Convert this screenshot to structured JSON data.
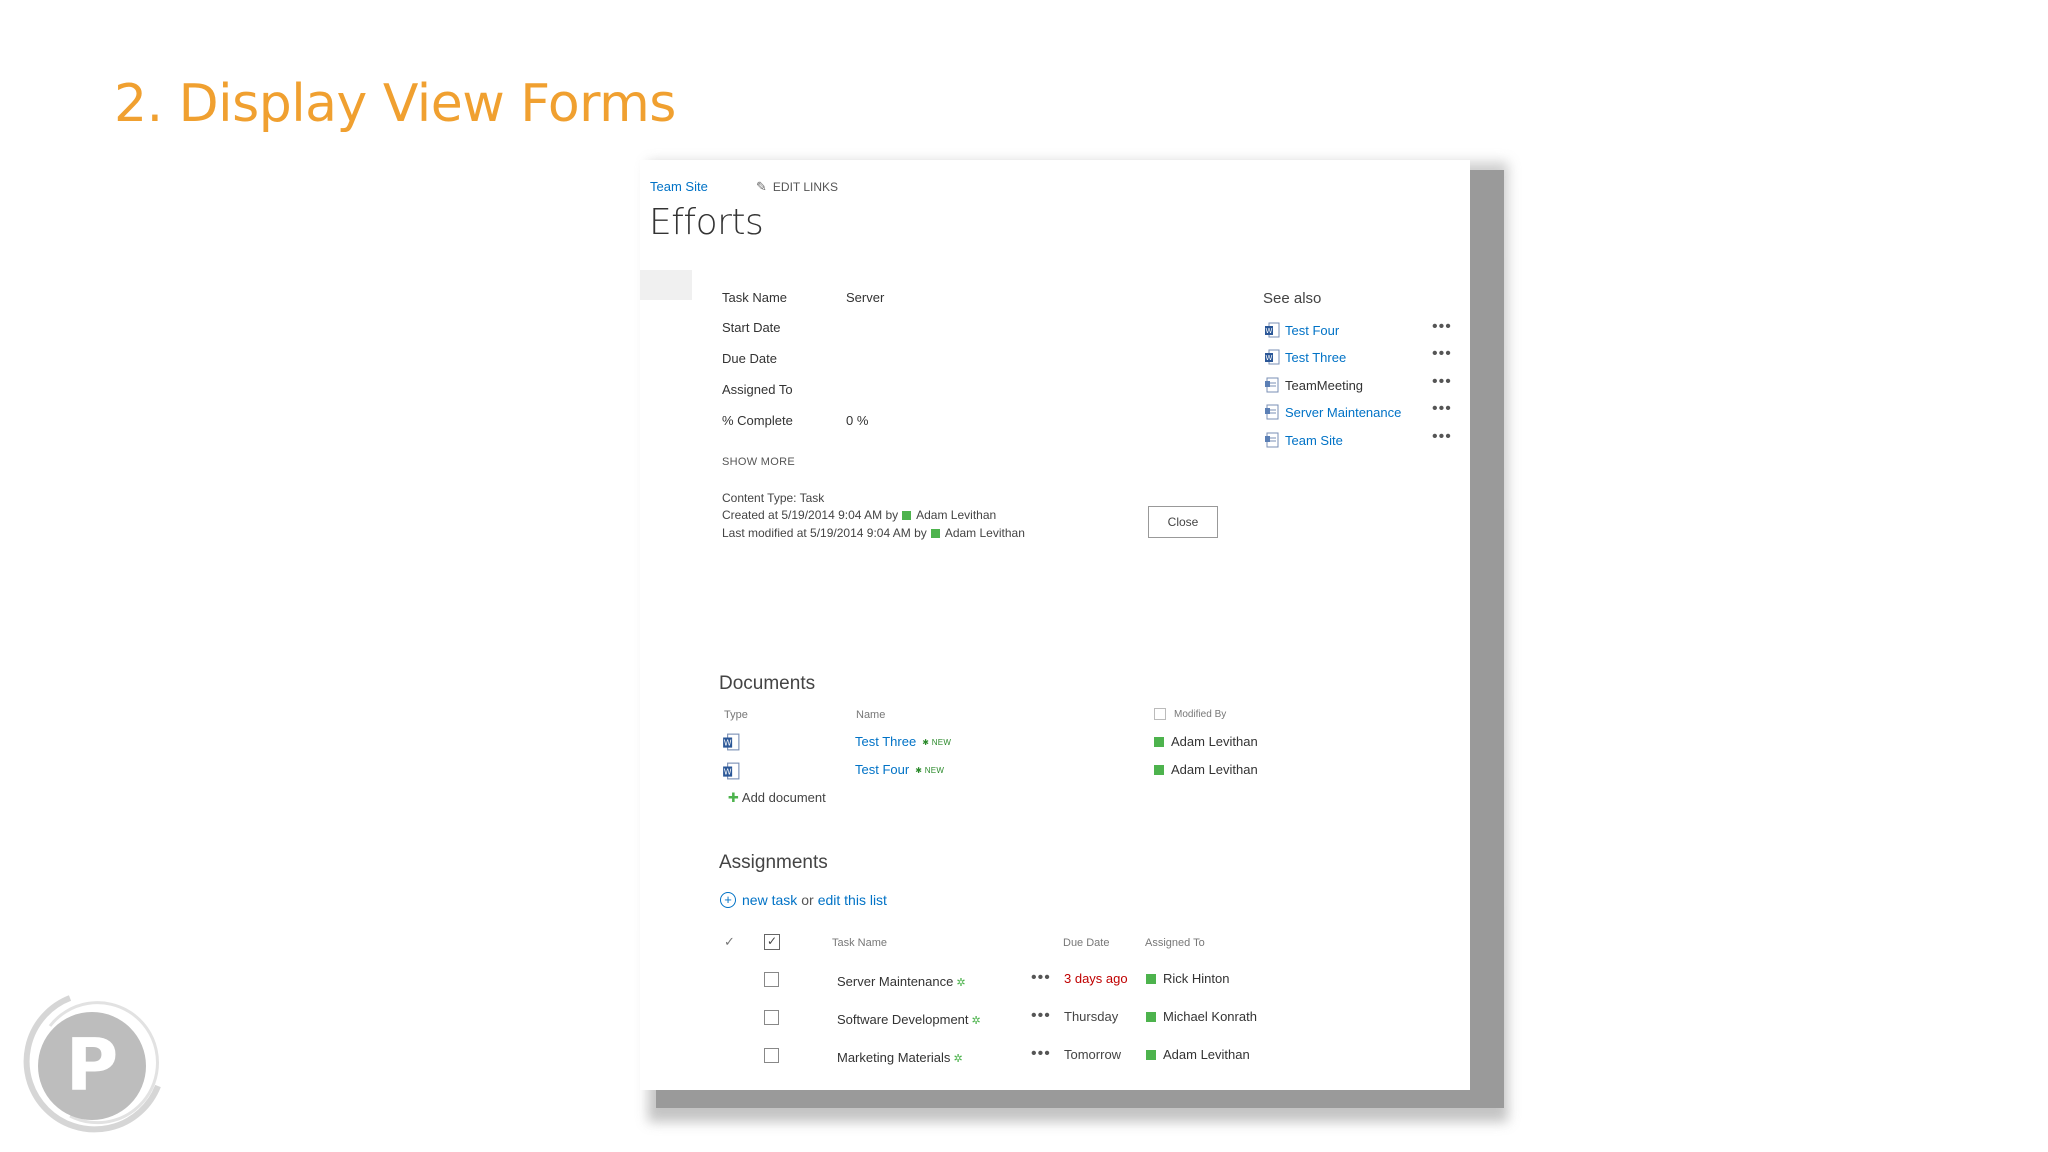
{
  "slide": {
    "title": "2. Display View Forms"
  },
  "header": {
    "breadcrumb_site": "Team Site",
    "edit_links": "EDIT LINKS",
    "page_title": "Efforts"
  },
  "form": {
    "fields": [
      {
        "label": "Task Name",
        "value": "Server"
      },
      {
        "label": "Start Date",
        "value": ""
      },
      {
        "label": "Due Date",
        "value": ""
      },
      {
        "label": "Assigned To",
        "value": ""
      },
      {
        "label": "% Complete",
        "value": "0 %"
      }
    ],
    "show_more": "SHOW MORE",
    "content_type": "Content Type: Task",
    "created_prefix": "Created at 5/19/2014 9:04 AM  by",
    "created_by": "Adam Levithan",
    "modified_prefix": "Last modified at 5/19/2014 9:04 AM  by",
    "modified_by": "Adam Levithan",
    "close_label": "Close"
  },
  "see_also": {
    "title": "See also",
    "items": [
      {
        "label": "Test Four",
        "icon": "word-document-icon"
      },
      {
        "label": "Test Three",
        "icon": "word-document-icon"
      },
      {
        "label": "TeamMeeting",
        "icon": "page-icon"
      },
      {
        "label": "Server Maintenance",
        "icon": "page-icon"
      },
      {
        "label": "Team Site",
        "icon": "page-icon"
      }
    ],
    "menu_glyph": "•••"
  },
  "documents": {
    "title": "Documents",
    "columns": {
      "type": "Type",
      "name": "Name",
      "modified_by": "Modified By"
    },
    "rows": [
      {
        "name": "Test Three",
        "badge": "✱ NEW",
        "modified_by": "Adam Levithan"
      },
      {
        "name": "Test Four",
        "badge": "✱ NEW",
        "modified_by": "Adam Levithan"
      }
    ],
    "add_label": "Add document"
  },
  "assignments": {
    "title": "Assignments",
    "new_task": "new task",
    "or_text": "or",
    "edit_list": "edit this list",
    "columns": {
      "task_name": "Task Name",
      "due_date": "Due Date",
      "assigned_to": "Assigned To"
    },
    "rows": [
      {
        "task": "Server Maintenance",
        "due": "3 days ago",
        "assigned": "Rick Hinton",
        "overdue": true
      },
      {
        "task": "Software Development",
        "due": "Thursday",
        "assigned": "Michael Konrath",
        "overdue": false
      },
      {
        "task": "Marketing Materials",
        "due": "Tomorrow",
        "assigned": "Adam Levithan",
        "overdue": false
      }
    ]
  },
  "colors": {
    "accent_orange": "#f0a030",
    "link_blue": "#0072c6",
    "presence_green": "#4db34d",
    "overdue_red": "#c00000"
  }
}
